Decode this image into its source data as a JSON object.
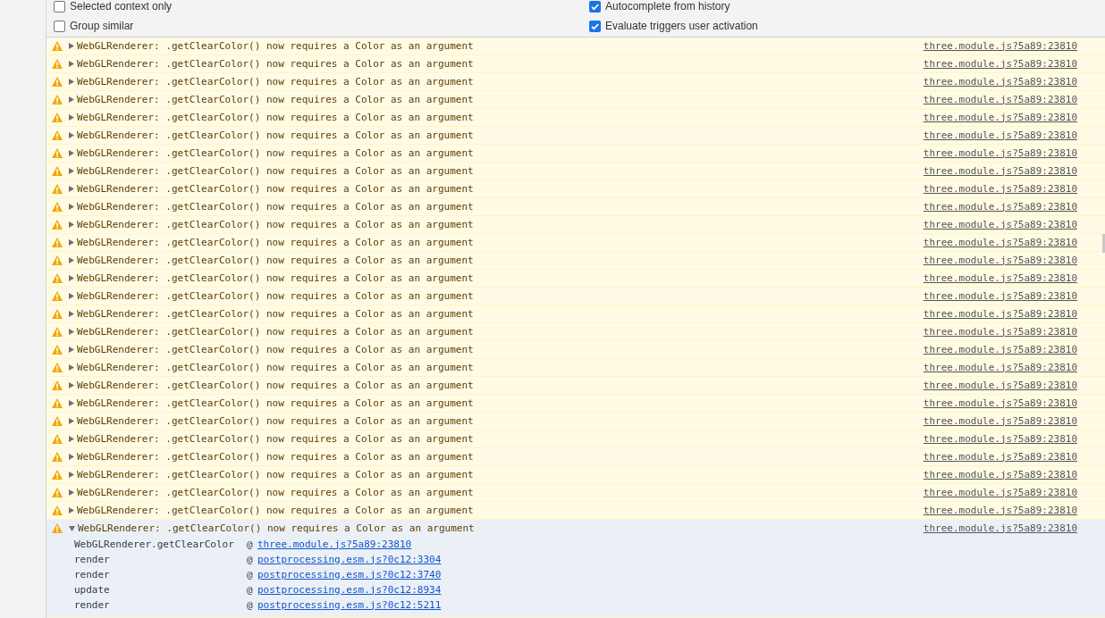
{
  "settings": {
    "left": [
      {
        "label": "Selected context only",
        "checked": false
      },
      {
        "label": "Group similar",
        "checked": false
      }
    ],
    "right": [
      {
        "label": "Autocomplete from history",
        "checked": true
      },
      {
        "label": "Evaluate triggers user activation",
        "checked": true
      }
    ]
  },
  "messages": [
    {
      "kind": "warning",
      "expanded": false,
      "selected": false,
      "text": "WebGLRenderer: .getClearColor() now requires a Color as an argument",
      "source": "three.module.js?5a89:23810"
    },
    {
      "kind": "warning",
      "expanded": false,
      "selected": false,
      "text": "WebGLRenderer: .getClearColor() now requires a Color as an argument",
      "source": "three.module.js?5a89:23810"
    },
    {
      "kind": "warning",
      "expanded": false,
      "selected": false,
      "text": "WebGLRenderer: .getClearColor() now requires a Color as an argument",
      "source": "three.module.js?5a89:23810"
    },
    {
      "kind": "warning",
      "expanded": false,
      "selected": false,
      "text": "WebGLRenderer: .getClearColor() now requires a Color as an argument",
      "source": "three.module.js?5a89:23810"
    },
    {
      "kind": "warning",
      "expanded": false,
      "selected": false,
      "text": "WebGLRenderer: .getClearColor() now requires a Color as an argument",
      "source": "three.module.js?5a89:23810"
    },
    {
      "kind": "warning",
      "expanded": false,
      "selected": false,
      "text": "WebGLRenderer: .getClearColor() now requires a Color as an argument",
      "source": "three.module.js?5a89:23810"
    },
    {
      "kind": "warning",
      "expanded": false,
      "selected": false,
      "text": "WebGLRenderer: .getClearColor() now requires a Color as an argument",
      "source": "three.module.js?5a89:23810"
    },
    {
      "kind": "warning",
      "expanded": false,
      "selected": false,
      "text": "WebGLRenderer: .getClearColor() now requires a Color as an argument",
      "source": "three.module.js?5a89:23810"
    },
    {
      "kind": "warning",
      "expanded": false,
      "selected": false,
      "text": "WebGLRenderer: .getClearColor() now requires a Color as an argument",
      "source": "three.module.js?5a89:23810"
    },
    {
      "kind": "warning",
      "expanded": false,
      "selected": false,
      "text": "WebGLRenderer: .getClearColor() now requires a Color as an argument",
      "source": "three.module.js?5a89:23810"
    },
    {
      "kind": "warning",
      "expanded": false,
      "selected": false,
      "text": "WebGLRenderer: .getClearColor() now requires a Color as an argument",
      "source": "three.module.js?5a89:23810"
    },
    {
      "kind": "warning",
      "expanded": false,
      "selected": false,
      "text": "WebGLRenderer: .getClearColor() now requires a Color as an argument",
      "source": "three.module.js?5a89:23810"
    },
    {
      "kind": "warning",
      "expanded": false,
      "selected": false,
      "text": "WebGLRenderer: .getClearColor() now requires a Color as an argument",
      "source": "three.module.js?5a89:23810"
    },
    {
      "kind": "warning",
      "expanded": false,
      "selected": false,
      "text": "WebGLRenderer: .getClearColor() now requires a Color as an argument",
      "source": "three.module.js?5a89:23810"
    },
    {
      "kind": "warning",
      "expanded": false,
      "selected": false,
      "text": "WebGLRenderer: .getClearColor() now requires a Color as an argument",
      "source": "three.module.js?5a89:23810"
    },
    {
      "kind": "warning",
      "expanded": false,
      "selected": false,
      "text": "WebGLRenderer: .getClearColor() now requires a Color as an argument",
      "source": "three.module.js?5a89:23810"
    },
    {
      "kind": "warning",
      "expanded": false,
      "selected": false,
      "text": "WebGLRenderer: .getClearColor() now requires a Color as an argument",
      "source": "three.module.js?5a89:23810"
    },
    {
      "kind": "warning",
      "expanded": false,
      "selected": false,
      "text": "WebGLRenderer: .getClearColor() now requires a Color as an argument",
      "source": "three.module.js?5a89:23810"
    },
    {
      "kind": "warning",
      "expanded": false,
      "selected": false,
      "text": "WebGLRenderer: .getClearColor() now requires a Color as an argument",
      "source": "three.module.js?5a89:23810"
    },
    {
      "kind": "warning",
      "expanded": false,
      "selected": false,
      "text": "WebGLRenderer: .getClearColor() now requires a Color as an argument",
      "source": "three.module.js?5a89:23810"
    },
    {
      "kind": "warning",
      "expanded": false,
      "selected": false,
      "text": "WebGLRenderer: .getClearColor() now requires a Color as an argument",
      "source": "three.module.js?5a89:23810"
    },
    {
      "kind": "warning",
      "expanded": false,
      "selected": false,
      "text": "WebGLRenderer: .getClearColor() now requires a Color as an argument",
      "source": "three.module.js?5a89:23810"
    },
    {
      "kind": "warning",
      "expanded": false,
      "selected": false,
      "text": "WebGLRenderer: .getClearColor() now requires a Color as an argument",
      "source": "three.module.js?5a89:23810"
    },
    {
      "kind": "warning",
      "expanded": false,
      "selected": false,
      "text": "WebGLRenderer: .getClearColor() now requires a Color as an argument",
      "source": "three.module.js?5a89:23810"
    },
    {
      "kind": "warning",
      "expanded": false,
      "selected": false,
      "text": "WebGLRenderer: .getClearColor() now requires a Color as an argument",
      "source": "three.module.js?5a89:23810"
    },
    {
      "kind": "warning",
      "expanded": false,
      "selected": false,
      "text": "WebGLRenderer: .getClearColor() now requires a Color as an argument",
      "source": "three.module.js?5a89:23810"
    },
    {
      "kind": "warning",
      "expanded": false,
      "selected": false,
      "text": "WebGLRenderer: .getClearColor() now requires a Color as an argument",
      "source": "three.module.js?5a89:23810"
    },
    {
      "kind": "warning",
      "expanded": true,
      "selected": true,
      "text": "WebGLRenderer: .getClearColor() now requires a Color as an argument",
      "source": "three.module.js?5a89:23810",
      "stack": [
        {
          "function": "WebGLRenderer.getClearColor",
          "at": "@",
          "source": "three.module.js?5a89:23810"
        },
        {
          "function": "render",
          "at": "@",
          "source": "postprocessing.esm.js?0c12:3304"
        },
        {
          "function": "render",
          "at": "@",
          "source": "postprocessing.esm.js?0c12:3740"
        },
        {
          "function": "update",
          "at": "@",
          "source": "postprocessing.esm.js?0c12:8934"
        },
        {
          "function": "render",
          "at": "@",
          "source": "postprocessing.esm.js?0c12:5211"
        }
      ]
    }
  ]
}
